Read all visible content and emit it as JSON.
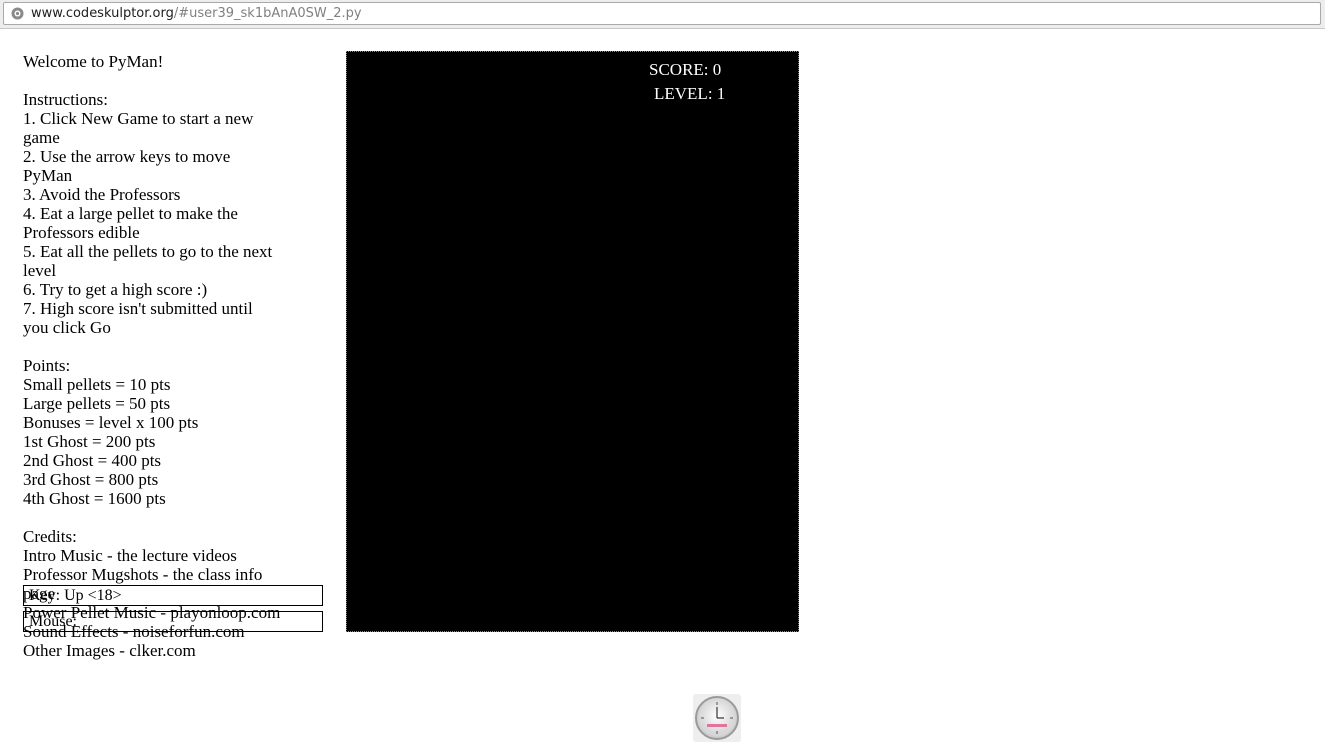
{
  "browser": {
    "url_domain": "www.codeskulptor.org",
    "url_path": "/#user39_sk1bAnA0SW_2.py"
  },
  "intro": {
    "welcome": "Welcome to PyMan!"
  },
  "instructions": {
    "heading": "Instructions:",
    "lines": [
      "1. Click New Game to start a new",
      "game",
      "2. Use the arrow keys to move",
      "PyMan",
      "3. Avoid the Professors",
      "4. Eat a large pellet to make the",
      "Professors edible",
      "5. Eat all the pellets to go to the next",
      "level",
      "6. Try to get a high score :)",
      "7. High score isn't submitted until",
      "you click Go"
    ]
  },
  "points": {
    "heading": "Points:",
    "lines": [
      "Small pellets = 10 pts",
      "Large pellets = 50 pts",
      "Bonuses = level x 100 pts",
      "1st Ghost = 200 pts",
      "2nd Ghost = 400 pts",
      "3rd Ghost = 800 pts",
      "4th Ghost = 1600 pts"
    ]
  },
  "credits": {
    "heading": "Credits:",
    "lines": [
      "Intro Music - the lecture videos",
      "Professor Mugshots - the class info",
      "page",
      "Power Pellet Music - playonloop.com",
      "Sound Effects - noiseforfun.com",
      "Other Images - clker.com"
    ]
  },
  "status": {
    "key_label": "Key: Up <18>",
    "mouse_label": "Mouse:"
  },
  "game": {
    "score_text": "SCORE: 0",
    "level_text": "LEVEL: 1",
    "background": "#000000"
  },
  "icons": {
    "timer": "timer-clock-icon",
    "site": "globe-icon"
  }
}
